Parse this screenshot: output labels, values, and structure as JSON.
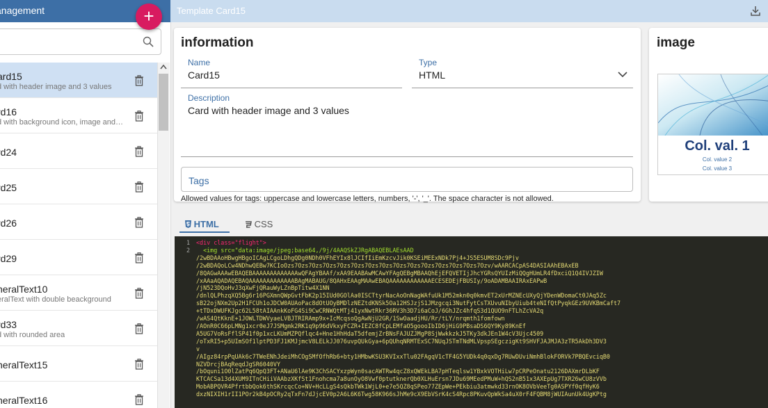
{
  "sidebar": {
    "title": "anagement",
    "add_label": "+",
    "items": [
      {
        "title": "ard15",
        "subtitle": "d with header image and 3 values",
        "selected": true
      },
      {
        "title": "rd16",
        "subtitle": "d with background icon, image and 2 ..."
      },
      {
        "title": "rd24",
        "subtitle": ""
      },
      {
        "title": "rd25",
        "subtitle": ""
      },
      {
        "title": "rd26",
        "subtitle": ""
      },
      {
        "title": "rd29",
        "subtitle": ""
      },
      {
        "title": "neralText10",
        "subtitle": "eralText with double beackground"
      },
      {
        "title": "rd33",
        "subtitle": "d with rounded area"
      },
      {
        "title": "neralText15",
        "subtitle": ""
      },
      {
        "title": "neralText16",
        "subtitle": ""
      }
    ]
  },
  "topbar": {
    "title": "Template Card15"
  },
  "info": {
    "heading": "information",
    "name_label": "Name",
    "name_value": "Card15",
    "type_label": "Type",
    "type_value": "HTML",
    "desc_label": "Description",
    "desc_value": "Card with header image and 3 values",
    "tags_label": "Tags",
    "tags_help": "Allowed values for tags: uppercase and lowercase letters, numbers, '-', '_'. The space character is not allowed."
  },
  "image_panel": {
    "heading": "image",
    "col_val_1": "Col. val. 1",
    "col_val_2": "Col. value 2",
    "col_val_3": "Col. value 3"
  },
  "tabs": {
    "html": "HTML",
    "css": "CSS",
    "active": "HTML"
  },
  "editor": {
    "line_numbers": [
      "1",
      "2"
    ],
    "line1_tag": "<div class=\"flight\">",
    "line2_tag": "<img src=\"data:image/jpeg;base64,/9j/4AAQSkZJRgABAQEBLAEsAAD",
    "code_lines": [
      "/2wBDAAoHBwgHBgoICAgLCgoLDhgQDg0NDh0VFhEYIx8lJCIfIiEmKzcvJik0KSEiMEExNDk7Pj4+JS5ESUM8SDc9Pjv",
      "/2wBDAQoLCw4NDhwQEBw7KCIoOzs7Ozs7Ozs7Ozs7Ozs7Ozs7Ozs7Ozs7Ozs7Ozs7Ozs7Ozs7Ozs7Ozs7Ozv/wAARCACpAS4DASIAAhEBAxEB",
      "/8QAGwAAAwEBAQEBAAAAAAAAAAAAAwQFAgYBAAf/xAA9EAABAwMCAwYFAgQEBgMBAAQhEjEFQVETIjJhcYGRsQYUIzMiQQgHUmLR4fDxciQ1Q4IVJZIW",
      "/xAAaAQADAQEBAQAAAAAAAAAAAAABAgMABAUG/8QAHxEAAgMAAwEBAQAAAAAAAAAAAAECESEDEjFBUSIy/9oADAMBAAIRAxEAPwB",
      "/jN523DQoHvJ3qXwFjQRauWyLZnBpTitw4X1NN",
      "/dnlQLPhzqXQ5Bg6r16PGXmnQWpGvtFbK2p15IUd0GOlAa0ISCTtyrNacAoOnNagWAfuUk1M52mkn0q0kmvET2xUrMZNEcUXyQjYDenWDomaCt0JAq5Zc",
      "sB22ojNXm2Up2H1FCUh1oJDCW0AUAoPac8dOtUOyBMDlzNEZtdKNSk5Oa12HSJzjS1JMzgcqi3NutFytCsTXUvuNIbyUiub4teNIfQtPyqkGEz9UVKBmCaft7",
      "+tTDxDWUFKJgc62L58tAIAAnkKoFG4Si9CwCRNWQtMTj41yxNwtRkr36RV3h3D7i6aCoJ/6GhJZc4hfqS3d1QUO9nFTLhZcVA2q",
      "/wAS4QtKknE+1JOWLTDWVyaeLVBJTRIRAmp9x+IcMcqsoQgAwNjU2GR/1SwOaadjHU/Rr/tLY/nrqmth1fomfown",
      "/AOnR0C66pLMNg1xcr0eJ7JSMgmk2RK1q9p96dVkxyFCZR+IEZC8fCpLEMfaO5goooIbID6jHiG9PBsaDS6QY9Ky89KnEf",
      "A5UG7VoRsFflSP41f0p1xcLKUmMZPQflqc4+Hne1HhHdaT5dfemjZrBNsFAJUZJMgP8SjWwkkzkJ5TKy3dkJEn1W4cV3Ujc4509",
      "/oTxRI5+p5UImSOf1lptPD3FJ1KMJjmcV8LELkJJ076uvpQUkGya+6pQUhqNRMTExSC7NUqJSTmTNdMLVpspSEgczigKt9SHVFJAJMJA3zTR5AkDh3DV3",
      "v",
      "/AIgz84rpPqUAk6c7TWeENhJdeiMhCOgSMfOfhRb6+bty1HMbwKSU3KVIxxTlu02FAgqV1cTF4G5YUDk4q0qxDg7RUwDUviNmhBlokFORVk7PBQEvciqB0",
      "NZVDrcjBAqReqdJgSR6040VY",
      "/bOquni1O0lZatPq6QpQ3FT+ANaU6lAe9K3ChSACYxzpWyn0sacAWTRw4qcZ8xQWEkLBA7pHTeqlsw1YBxkVOTHiLw7pCRPeOnatu2126DAXmrDLbKF",
      "KTCACSa13d4XUM9ITnCHiiVAAbzXKfSt1Fnohcma7a8unOyO8Vwf0ptutknerQb0XLHuErsn7JDu69MEedPMuW+hQS2nB51x3AXEpUg7TXR26wCU8zVVb",
      "MobABPQVR4PfrtbbQok6thSKrcqcCo+NV+HcLLgS4sQkbTWk1WjL0+e7e5QZ8qSPeo77ZEpWe+PEkbiu3atmwkd33rnOK8OVbVeeTg0ASPYf0qfHyK6",
      "dxzNIXIH1rII1POr2kB4pOCRy2qTxFn7dJjcEV0p2A6L6K6Twg58K966sJhMe9cX9EbVSrK4cS4Rpc8PKuvQpWkSa4uX0rF4FQBM8jWUIAunUk4UgKPtg"
    ]
  }
}
